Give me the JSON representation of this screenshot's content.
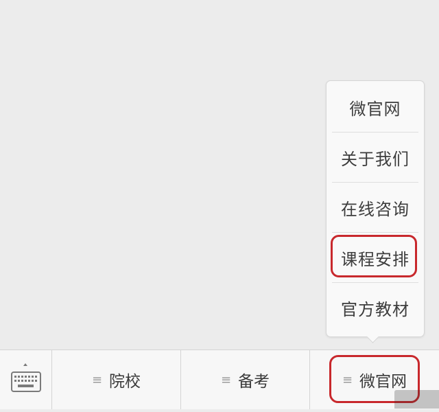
{
  "popup_menu": {
    "items": [
      "微官网",
      "关于我们",
      "在线咨询",
      "课程安排",
      "官方教材"
    ]
  },
  "bottom_bar": {
    "tabs": [
      {
        "label": "院校",
        "icon": "menu-lines-icon"
      },
      {
        "label": "备考",
        "icon": "menu-lines-icon"
      },
      {
        "label": "微官网",
        "icon": "menu-lines-icon"
      }
    ],
    "keyboard_icon": "keyboard-icon"
  },
  "colors": {
    "background": "#ececec",
    "highlight_red": "#c8282c",
    "bar_background": "#f7f7f7"
  }
}
